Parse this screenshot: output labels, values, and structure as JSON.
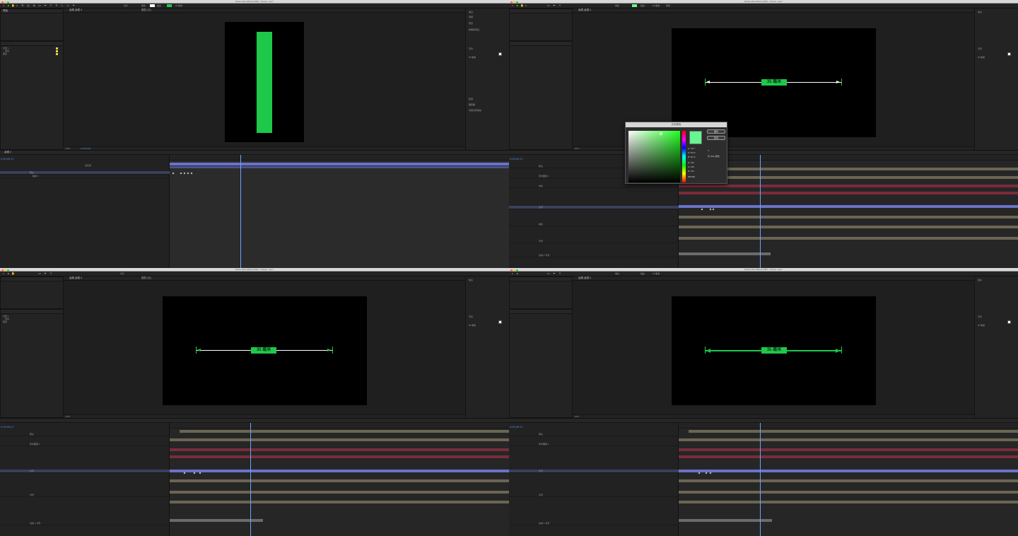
{
  "app": {
    "window_title": "Adobe After Effects 2020 - /Users/...aep *",
    "accent_color": "#1ec84a",
    "timeline_accent": "#6fa1ff"
  },
  "toolbar": {
    "snapping_label": "对齐",
    "fill_label": "填充",
    "stroke_label": "描边",
    "stroke_px": "20 像素",
    "add_label": "添加"
  },
  "project_panel": {
    "tab": "项目",
    "items": [
      "合成 1",
      "纯色",
      "图层"
    ]
  },
  "comp_panel": {
    "tab": "合成 合成 1",
    "layer_tab": "图层 (无)",
    "breadcrumb": "合成 1"
  },
  "viewer_footer": {
    "zoom": "50%",
    "timecode": "0:00:00:00",
    "resolution": "完整",
    "camera": "活动摄像机",
    "views": "1个"
  },
  "right_panel": {
    "items": [
      "信息",
      "音频",
      "预览",
      "效果和预设",
      "对齐",
      "库",
      "字符",
      "段落",
      "跟踪器",
      "内容识别填充"
    ],
    "font_size": "50 像素",
    "leading": "自动"
  },
  "label_text": "35 毫米",
  "timeline": {
    "tab": "合成 1",
    "timecode": "0:00:00:17",
    "columns": [
      "源名称",
      "模式",
      "TrkMat",
      "父级和链接"
    ],
    "layers": [
      "箭头",
      "形状图层 1",
      "线条",
      "文字",
      "35 毫米",
      "描边",
      "矩形 1",
      "填充 1",
      "变换",
      "路径 1",
      "背景",
      "合成 1 背景"
    ]
  },
  "color_picker": {
    "title": "文本颜色",
    "ok_label": "确定",
    "cancel_label": "取消",
    "rows": [
      "H: 137 °",
      "S: 59 %",
      "B: 96 %",
      "R: 102",
      "G: 245",
      "B: 143"
    ],
    "hex": "66F58F",
    "eyedropper": "吸管",
    "web_only": "仅 Web 颜色"
  }
}
